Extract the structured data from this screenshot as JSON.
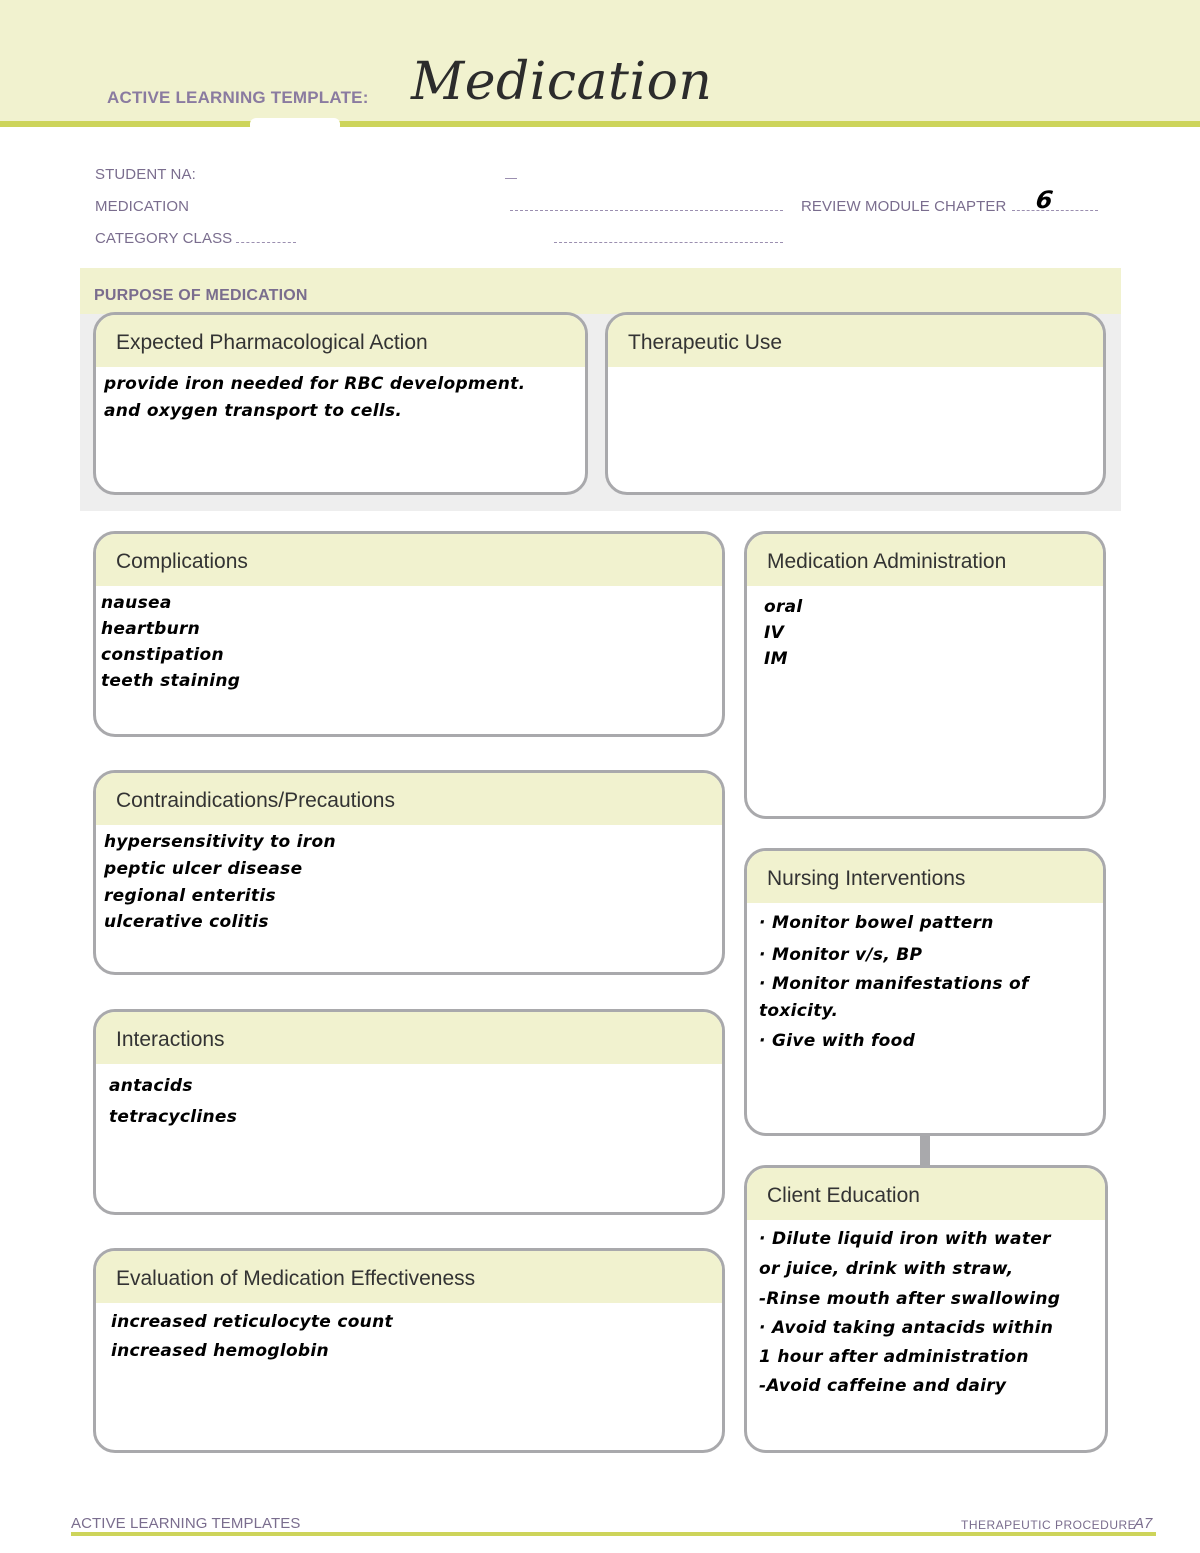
{
  "header": {
    "label": "ACTIVE LEARNING TEMPLATE:",
    "title": "Medication"
  },
  "fields": {
    "student_name_label": "STUDENT NA:",
    "medication_label": "MEDICATION",
    "review_module_chapter_label": "REVIEW MODULE CHAPTER",
    "review_module_chapter_value": "6",
    "category_class_label": "CATEGORY CLASS"
  },
  "purpose": {
    "title": "PURPOSE OF MEDICATION",
    "expected_action": {
      "heading": "Expected Pharmacological Action",
      "lines": [
        "provide iron needed for RBC development.",
        "and oxygen transport to cells."
      ]
    },
    "therapeutic_use": {
      "heading": "Therapeutic Use",
      "lines": []
    }
  },
  "sections": {
    "complications": {
      "heading": "Complications",
      "lines": [
        "nausea",
        "heartburn",
        "constipation",
        "teeth staining"
      ]
    },
    "medication_administration": {
      "heading": "Medication Administration",
      "lines": [
        "oral",
        "IV",
        "IM"
      ]
    },
    "contraindications": {
      "heading": "Contraindications/Precautions",
      "lines": [
        "hypersensitivity to iron",
        "peptic ulcer disease",
        "regional enteritis",
        "ulcerative colitis"
      ]
    },
    "nursing_interventions": {
      "heading": "Nursing Interventions",
      "lines": [
        "· Monitor bowel pattern",
        "· Monitor v/s, BP",
        "· Monitor manifestations of",
        "  toxicity.",
        "· Give with food"
      ]
    },
    "interactions": {
      "heading": "Interactions",
      "lines": [
        "antacids",
        "tetracyclines"
      ]
    },
    "client_education": {
      "heading": "Client Education",
      "lines": [
        "· Dilute liquid iron with water",
        "  or juice, drink with straw,",
        "-Rinse mouth after swallowing",
        "· Avoid taking antacids within",
        "  1 hour after administration",
        "-Avoid caffeine and dairy"
      ]
    },
    "evaluation": {
      "heading": "Evaluation of Medication Effectiveness",
      "lines": [
        "increased reticulocyte count",
        "increased hemoglobin"
      ]
    }
  },
  "footer": {
    "left": "ACTIVE LEARNING TEMPLATES",
    "right": "THERAPEUTIC PROCEDURE",
    "page": "A7"
  },
  "colors": {
    "header_band": "#f1f2cf",
    "accent_rule": "#cdd45a",
    "label_purple": "#7a6d8e",
    "card_border": "#a9a9ac"
  }
}
